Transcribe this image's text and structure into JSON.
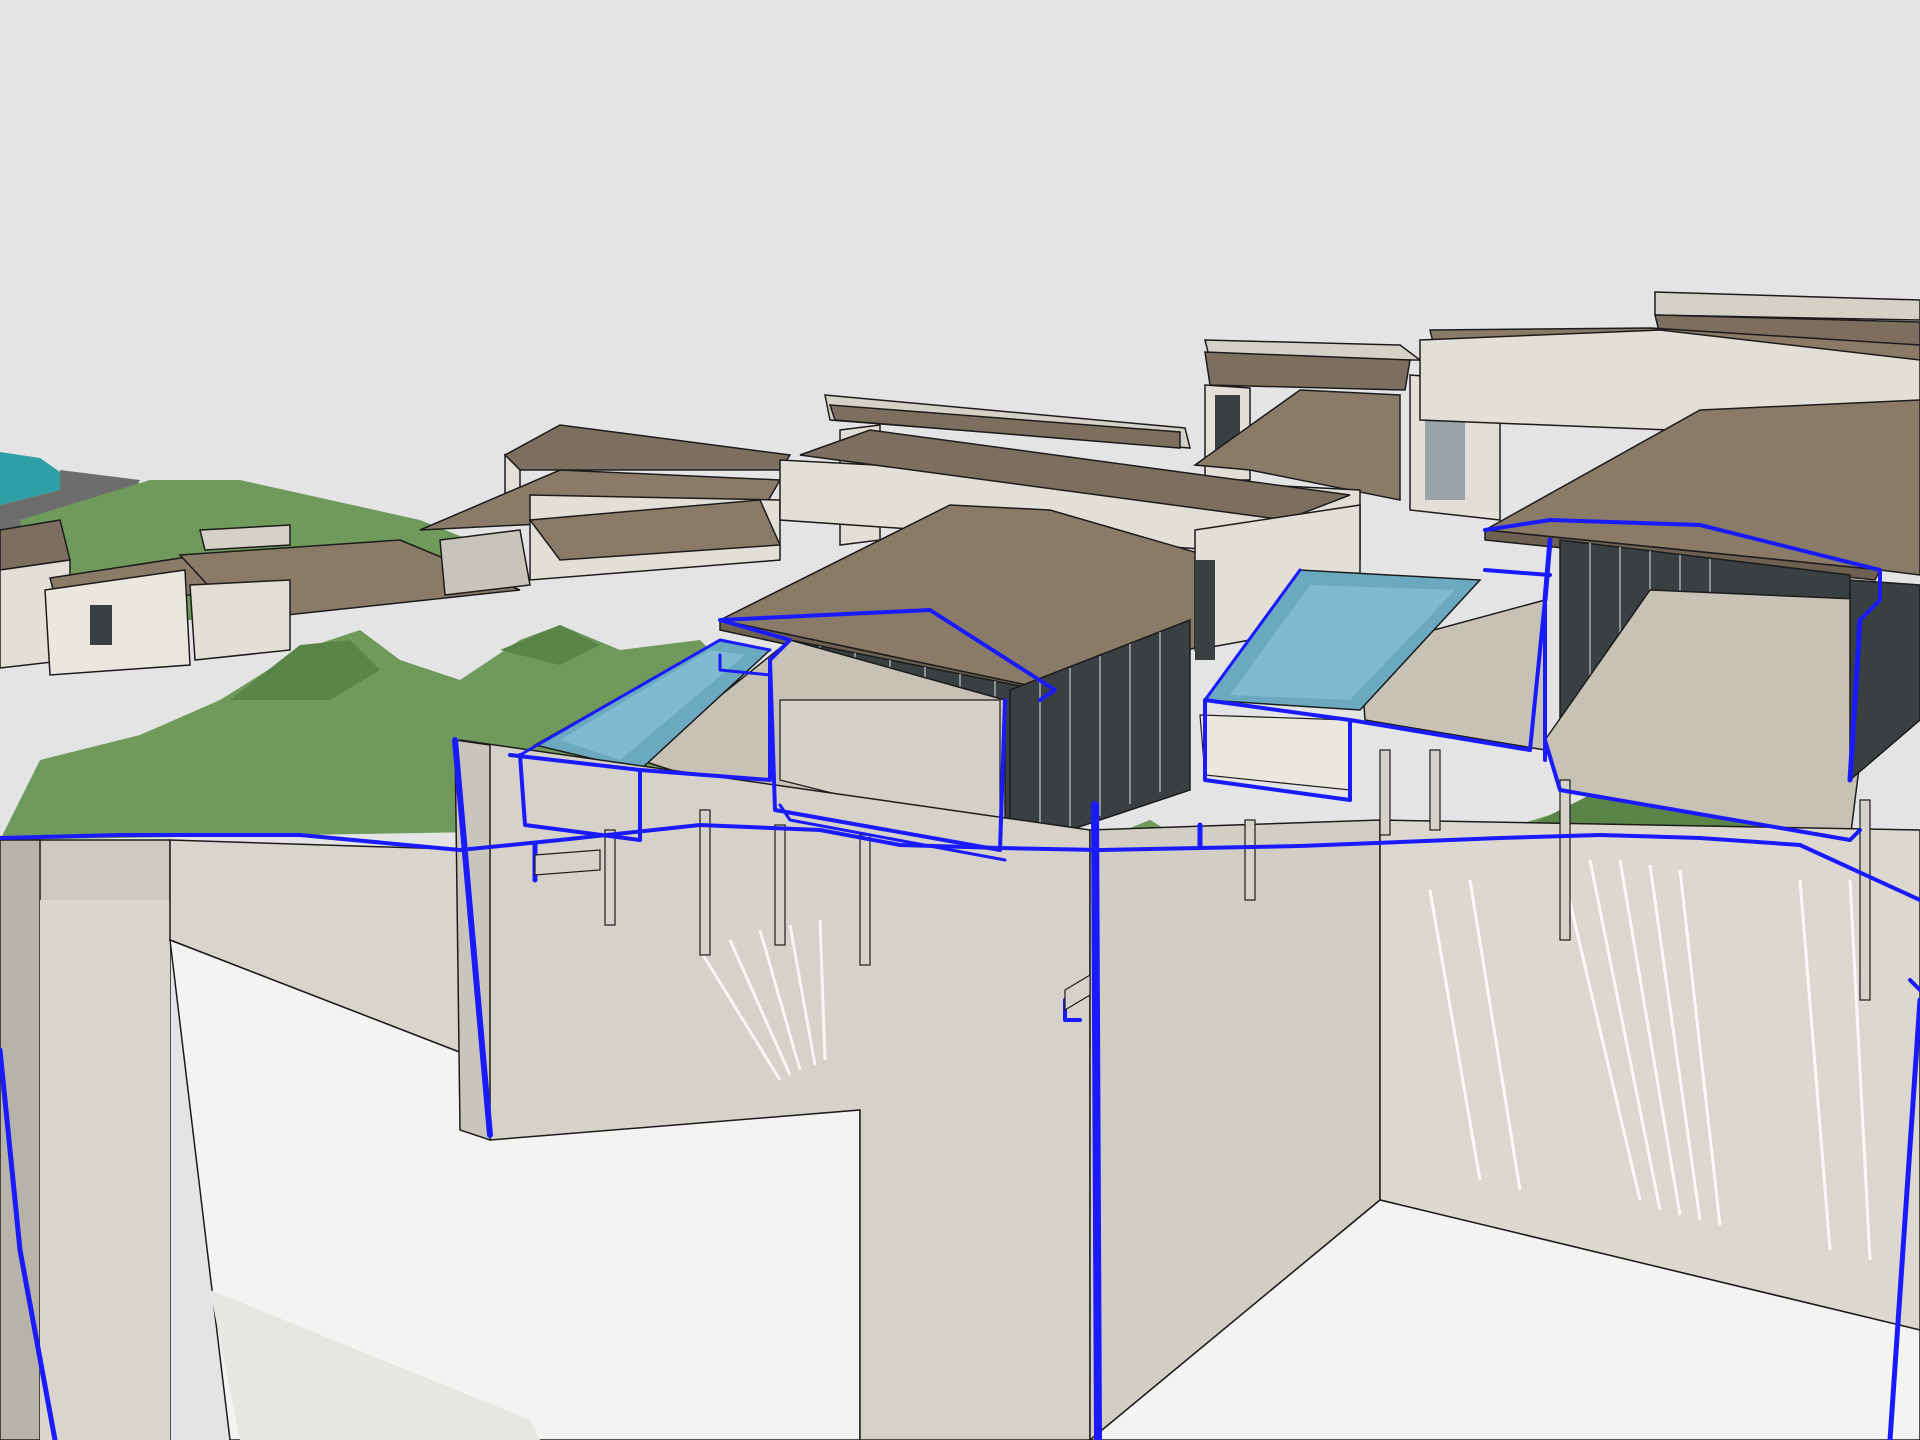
{
  "viewport": {
    "mode": "section-cut-3d-model",
    "colors": {
      "sky": "#e4e4e4",
      "section_fill_blue": "#1a1aff",
      "roof": "#8a7a68",
      "roof_dark": "#6e6152",
      "wall": "#e3dfd6",
      "wall_shadow": "#c9c4ba",
      "terrain": "#6f9a5c",
      "terrain_dark": "#5b8449",
      "pool_water": "#6aa9c0",
      "deck": "#c8c2b6",
      "glass": "#3a3f42",
      "ground_cut": "#d8d4cb",
      "ground_light": "#f3f3f1",
      "sea": "#2e9fa6",
      "edge": "#1c1c1c"
    },
    "objects": [
      {
        "name": "section-plane-left",
        "kind": "section-cut"
      },
      {
        "name": "section-plane-mid",
        "kind": "section-cut"
      },
      {
        "name": "section-plane-right",
        "kind": "section-cut"
      },
      {
        "name": "villa-front-left",
        "kind": "building"
      },
      {
        "name": "villa-front-right",
        "kind": "building"
      },
      {
        "name": "pool-left",
        "kind": "pool"
      },
      {
        "name": "pool-right",
        "kind": "pool"
      },
      {
        "name": "hillside-terrain",
        "kind": "terrain"
      },
      {
        "name": "background-villas",
        "kind": "building-group"
      }
    ]
  }
}
